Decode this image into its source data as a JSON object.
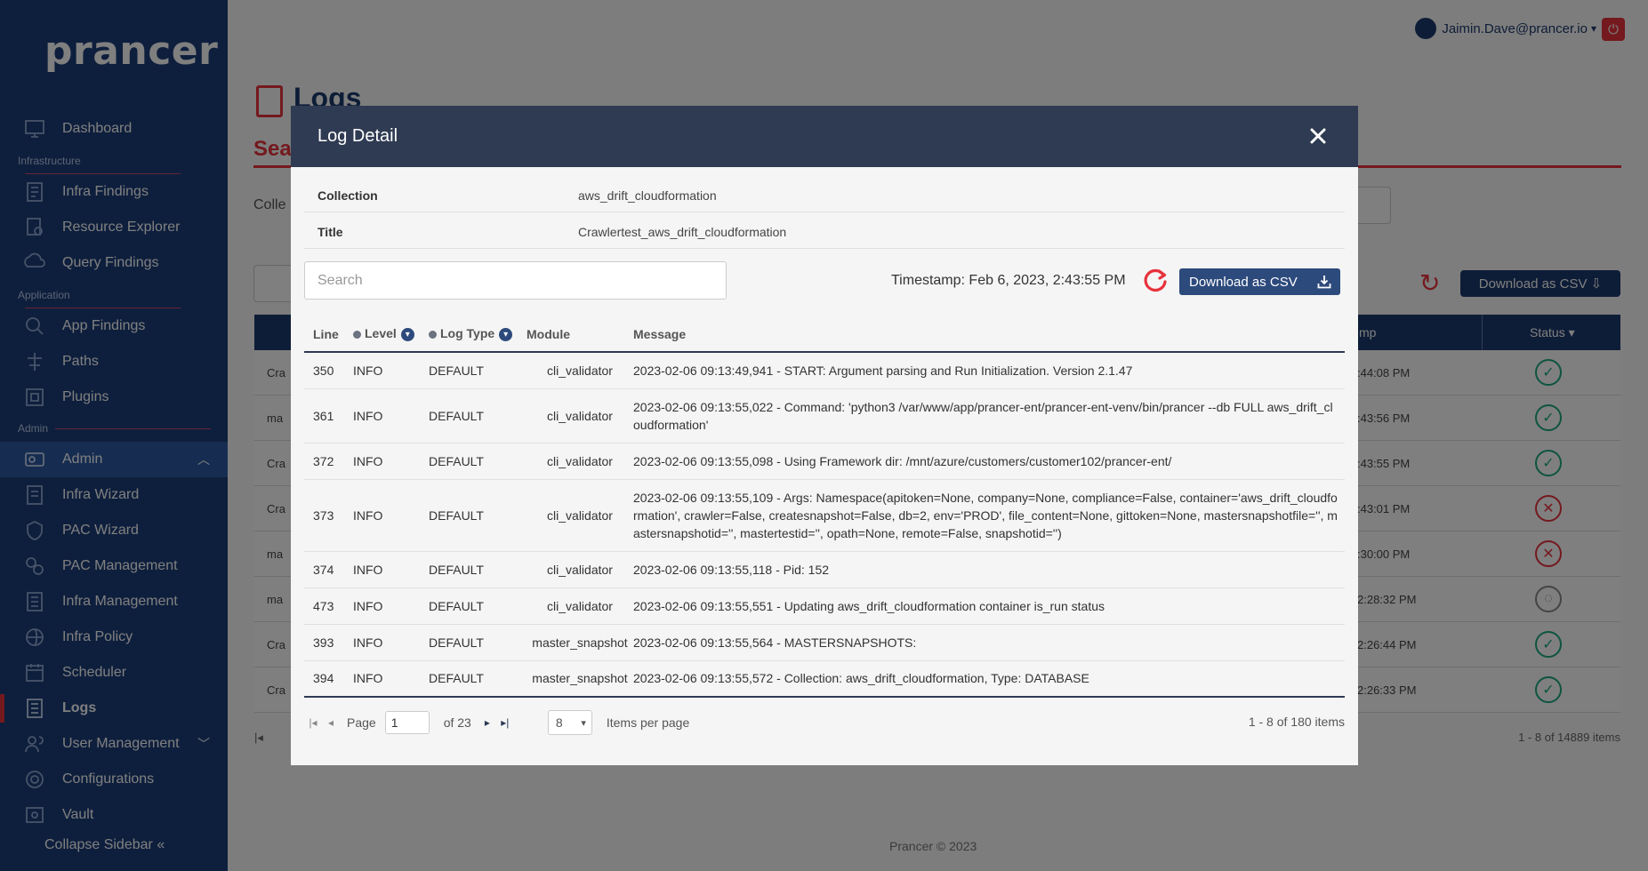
{
  "app": {
    "logo": "prancer",
    "user_email": "Jaimin.Dave@prancer.io",
    "page_title": "Logs",
    "sub_tab": "Sea",
    "collection_label_partial": "Colle",
    "footer": "Prancer © 2023"
  },
  "sidebar": {
    "sections": {
      "infrastructure": "Infrastructure",
      "application": "Application",
      "admin": "Admin"
    },
    "items": [
      {
        "label": "Dashboard",
        "icon": "dashboard-icon"
      },
      {
        "label": "Infra Findings",
        "icon": "infra-findings-icon"
      },
      {
        "label": "Resource Explorer",
        "icon": "resource-explorer-icon"
      },
      {
        "label": "Query Findings",
        "icon": "query-findings-icon"
      },
      {
        "label": "App Findings",
        "icon": "app-findings-icon"
      },
      {
        "label": "Paths",
        "icon": "paths-icon"
      },
      {
        "label": "Plugins",
        "icon": "plugins-icon"
      },
      {
        "label": "Admin",
        "icon": "admin-icon"
      },
      {
        "label": "Infra Wizard",
        "icon": "infra-wizard-icon"
      },
      {
        "label": "PAC Wizard",
        "icon": "pac-wizard-icon"
      },
      {
        "label": "PAC Management",
        "icon": "pac-management-icon"
      },
      {
        "label": "Infra Management",
        "icon": "infra-management-icon"
      },
      {
        "label": "Infra Policy",
        "icon": "infra-policy-icon"
      },
      {
        "label": "Scheduler",
        "icon": "scheduler-icon"
      },
      {
        "label": "Logs",
        "icon": "logs-icon"
      },
      {
        "label": "User Management",
        "icon": "user-management-icon"
      },
      {
        "label": "Configurations",
        "icon": "configurations-icon"
      },
      {
        "label": "Vault",
        "icon": "vault-icon"
      }
    ],
    "collapse_label": "Collapse Sidebar"
  },
  "background_table": {
    "download_label": "Download as CSV",
    "search_placeholder_partial": "Se",
    "headers": {
      "timestamp_partial": "mp",
      "status": "Status"
    },
    "rows": [
      {
        "lead": "Cra",
        "time": ":44:08 PM",
        "status": "success"
      },
      {
        "lead": "ma",
        "time": ":43:56 PM",
        "status": "success"
      },
      {
        "lead": "Cra",
        "time": ":43:55 PM",
        "status": "success"
      },
      {
        "lead": "Cra",
        "time": ":43:01 PM",
        "status": "error"
      },
      {
        "lead": "ma",
        "time": ":30:00 PM",
        "status": "error"
      },
      {
        "lead": "ma",
        "time": "2:28:32 PM",
        "status": "running"
      },
      {
        "lead": "Cra",
        "time": "2:26:44 PM",
        "status": "success"
      },
      {
        "lead": "Cra",
        "time": "2:26:33 PM",
        "status": "success"
      }
    ],
    "pager_summary": "1 - 8 of 14889 items"
  },
  "modal": {
    "title": "Log Detail",
    "info": [
      {
        "key": "Collection",
        "value": "aws_drift_cloudformation"
      },
      {
        "key": "Title",
        "value": "Crawlertest_aws_drift_cloudformation"
      }
    ],
    "search_placeholder": "Search",
    "timestamp": "Timestamp: Feb 6, 2023, 2:43:55 PM",
    "download_label": "Download as CSV",
    "columns": {
      "line": "Line",
      "level": "Level",
      "log_type": "Log Type",
      "module": "Module",
      "message": "Message"
    },
    "rows": [
      {
        "line": "350",
        "level": "INFO",
        "type": "DEFAULT",
        "module": "cli_validator",
        "message": "2023-02-06 09:13:49,941 - START: Argument parsing and Run Initialization. Version 2.1.47"
      },
      {
        "line": "361",
        "level": "INFO",
        "type": "DEFAULT",
        "module": "cli_validator",
        "message": "2023-02-06 09:13:55,022 - Command: 'python3 /var/www/app/prancer-ent/prancer-ent-venv/bin/prancer --db FULL aws_drift_cloudformation'"
      },
      {
        "line": "372",
        "level": "INFO",
        "type": "DEFAULT",
        "module": "cli_validator",
        "message": "2023-02-06 09:13:55,098 - Using Framework dir: /mnt/azure/customers/customer102/prancer-ent/"
      },
      {
        "line": "373",
        "level": "INFO",
        "type": "DEFAULT",
        "module": "cli_validator",
        "message": "2023-02-06 09:13:55,109 - Args: Namespace(apitoken=None, company=None, compliance=False, container='aws_drift_cloudformation', crawler=False, createsnapshot=False, db=2, env='PROD', file_content=None, gittoken=None, mastersnapshotfile='', mastersnapshotid='', mastertestid='', opath=None, remote=False, snapshotid='')"
      },
      {
        "line": "374",
        "level": "INFO",
        "type": "DEFAULT",
        "module": "cli_validator",
        "message": "2023-02-06 09:13:55,118 - Pid: 152"
      },
      {
        "line": "473",
        "level": "INFO",
        "type": "DEFAULT",
        "module": "cli_validator",
        "message": "2023-02-06 09:13:55,551 - Updating aws_drift_cloudformation container is_run status"
      },
      {
        "line": "393",
        "level": "INFO",
        "type": "DEFAULT",
        "module": "master_snapshot",
        "message": "2023-02-06 09:13:55,564 - MASTERSNAPSHOTS:"
      },
      {
        "line": "394",
        "level": "INFO",
        "type": "DEFAULT",
        "module": "master_snapshot",
        "message": "2023-02-06 09:13:55,572 - Collection: aws_drift_cloudformation, Type: DATABASE"
      }
    ],
    "pager": {
      "page_label": "Page",
      "page_value": "1",
      "of_label": "of 23",
      "per_page_value": "8",
      "per_page_label": "Items per page",
      "summary": "1 - 8 of 180 items"
    }
  }
}
